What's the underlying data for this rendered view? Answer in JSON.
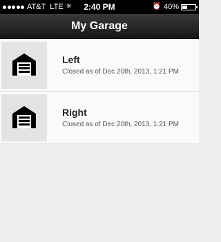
{
  "status_bar": {
    "carrier": "AT&T",
    "network": "LTE",
    "time": "2:40 PM",
    "battery_text": "40%",
    "battery_level": 0.4
  },
  "nav": {
    "title": "My Garage"
  },
  "doors": [
    {
      "name": "Left",
      "status": "Closed as of Dec 20th, 2013, 1:21 PM",
      "icon": "garage-icon"
    },
    {
      "name": "Right",
      "status": "Closed as of Dec 20th, 2013, 1:21 PM",
      "icon": "garage-icon"
    }
  ]
}
